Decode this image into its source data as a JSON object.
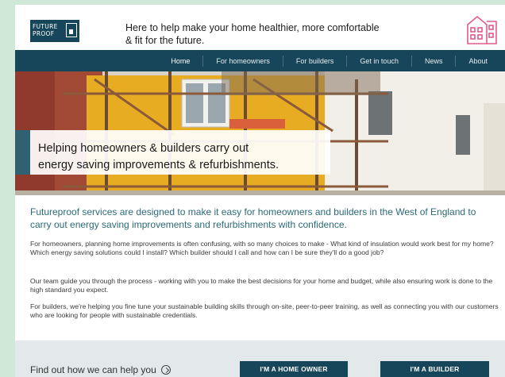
{
  "brand": {
    "logo_line1": "FUTURE",
    "logo_line2": "PROOF",
    "tagline": "Here to help make your home healthier, more comfortable & fit for the future.",
    "colors": {
      "primary": "#17465b",
      "accent_pink": "#e35a8d",
      "intro_text": "#2b6a78",
      "page_bg": "#cfe8d8"
    }
  },
  "nav": {
    "items": [
      {
        "label": "Home",
        "active": true
      },
      {
        "label": "For homeowners"
      },
      {
        "label": "For builders"
      },
      {
        "label": "Get in touch"
      },
      {
        "label": "News"
      },
      {
        "label": "About"
      }
    ]
  },
  "hero": {
    "caption_line1": "Helping homeowners & builders carry out",
    "caption_line2": "energy saving improvements & refurbishments."
  },
  "content": {
    "intro": "Futureproof services are designed to make it easy for homeowners and builders in the West of England to carry out energy saving improvements and refurbishments with confidence.",
    "para1": "For homeowners, planning home improvements is often confusing, with so many choices to make - What kind of insulation would work best for my home? Which energy saving solutions could I install? Which builder should I call and how can I be sure they'll do a good job?",
    "para2": "Our team guide you through the process - working with you to make the best decisions for your home and budget, while also ensuring work is done to the high standard you expect.",
    "para3": "For builders, we're helping you fine tune your sustainable building skills through on-site, peer-to-peer training, as well as connecting you with our customers who are looking for people with sustainable credentials."
  },
  "cta": {
    "text": "Find out how we can help you",
    "homeowner_button": "I'M A HOME OWNER",
    "builder_button": "I'M A BUILDER"
  }
}
